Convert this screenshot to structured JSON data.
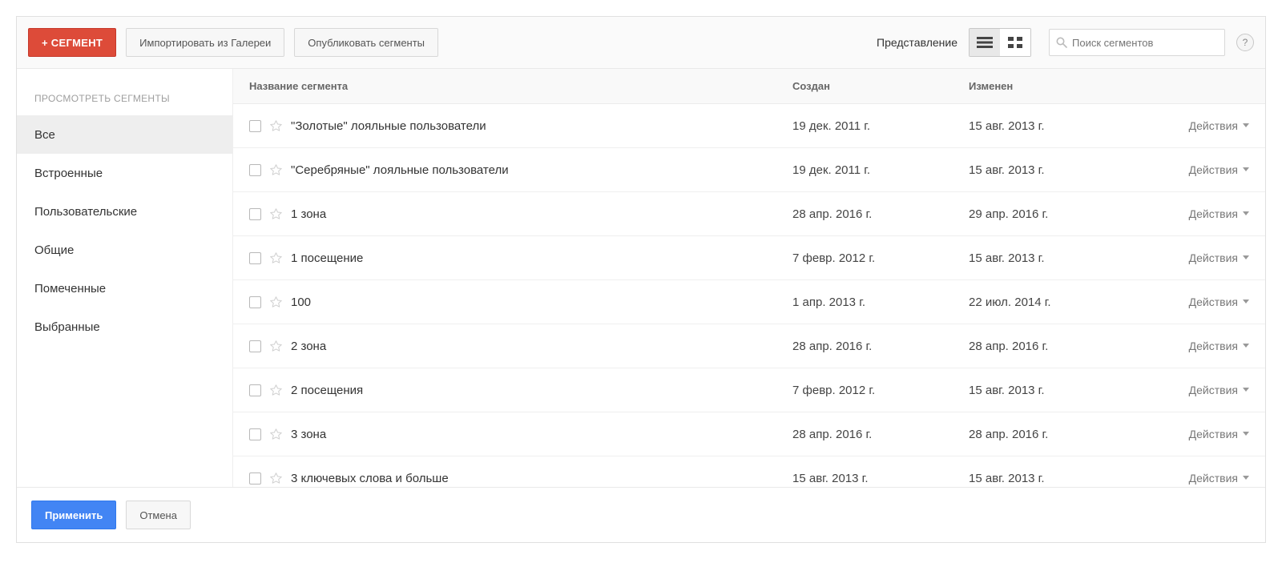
{
  "toolbar": {
    "new_segment": "+ СЕГМЕНТ",
    "import_gallery": "Импортировать из Галереи",
    "publish_segments": "Опубликовать сегменты",
    "view_label": "Представление",
    "search_placeholder": "Поиск сегментов"
  },
  "sidebar": {
    "heading": "ПРОСМОТРЕТЬ СЕГМЕНТЫ",
    "items": [
      {
        "label": "Все",
        "active": true
      },
      {
        "label": "Встроенные",
        "active": false
      },
      {
        "label": "Пользовательские",
        "active": false
      },
      {
        "label": "Общие",
        "active": false
      },
      {
        "label": "Помеченные",
        "active": false
      },
      {
        "label": "Выбранные",
        "active": false
      }
    ]
  },
  "table": {
    "headers": {
      "name": "Название сегмента",
      "created": "Создан",
      "modified": "Изменен"
    },
    "actions_label": "Действия",
    "rows": [
      {
        "name": "\"Золотые\" лояльные пользователи",
        "created": "19 дек. 2011 г.",
        "modified": "15 авг. 2013 г."
      },
      {
        "name": "\"Серебряные\" лояльные пользователи",
        "created": "19 дек. 2011 г.",
        "modified": "15 авг. 2013 г."
      },
      {
        "name": "1 зона",
        "created": "28 апр. 2016 г.",
        "modified": "29 апр. 2016 г."
      },
      {
        "name": "1 посещение",
        "created": "7 февр. 2012 г.",
        "modified": "15 авг. 2013 г."
      },
      {
        "name": "100",
        "created": "1 апр. 2013 г.",
        "modified": "22 июл. 2014 г."
      },
      {
        "name": "2 зона",
        "created": "28 апр. 2016 г.",
        "modified": "28 апр. 2016 г."
      },
      {
        "name": "2 посещения",
        "created": "7 февр. 2012 г.",
        "modified": "15 авг. 2013 г."
      },
      {
        "name": "3 зона",
        "created": "28 апр. 2016 г.",
        "modified": "28 апр. 2016 г."
      },
      {
        "name": "3 ключевых слова и больше",
        "created": "15 авг. 2013 г.",
        "modified": "15 авг. 2013 г."
      }
    ]
  },
  "footer": {
    "apply": "Применить",
    "cancel": "Отмена"
  }
}
